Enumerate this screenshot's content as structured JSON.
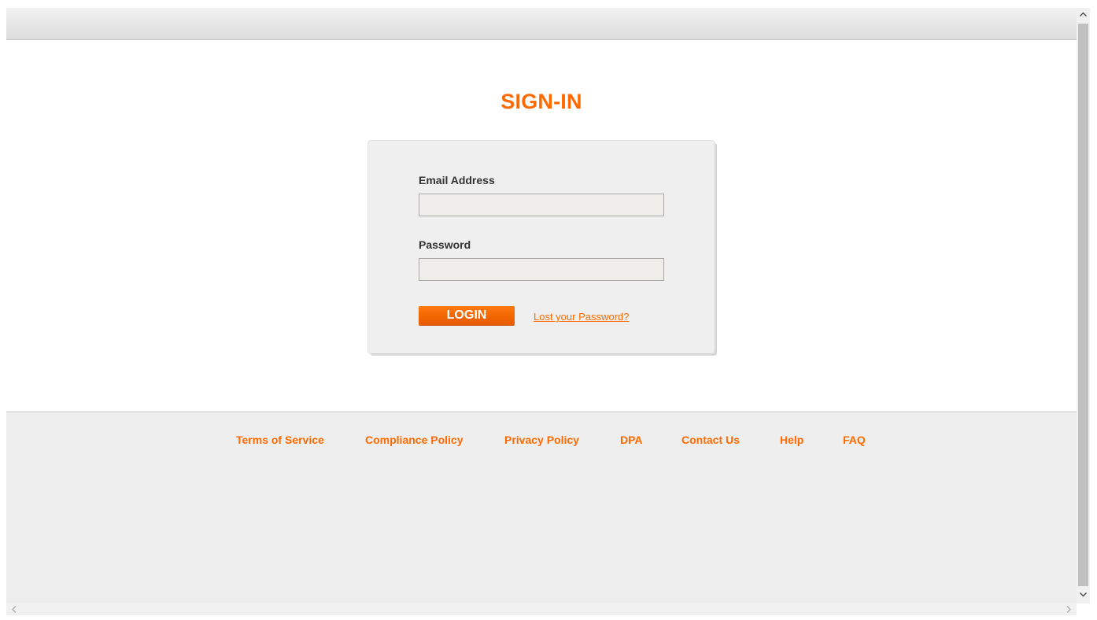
{
  "page": {
    "title": "SIGN-IN"
  },
  "login_form": {
    "email_label": "Email Address",
    "email_value": "",
    "email_placeholder": "",
    "password_label": "Password",
    "password_value": "",
    "password_placeholder": "",
    "login_button": "LOGIN",
    "lost_password_link": "Lost your Password?"
  },
  "footer": {
    "links": [
      "Terms of Service",
      "Compliance Policy",
      "Privacy Policy",
      "DPA",
      "Contact Us",
      "Help",
      "FAQ"
    ]
  },
  "scrollbars": {
    "up_icon": "chevron-up-icon",
    "down_icon": "chevron-down-icon",
    "left_icon": "chevron-left-icon",
    "right_icon": "chevron-right-icon"
  },
  "colors": {
    "accent": "#ff6a00",
    "panel_background": "#efefef",
    "footer_background": "#eeeeee",
    "input_background": "#efedea",
    "label_text": "#333333"
  }
}
